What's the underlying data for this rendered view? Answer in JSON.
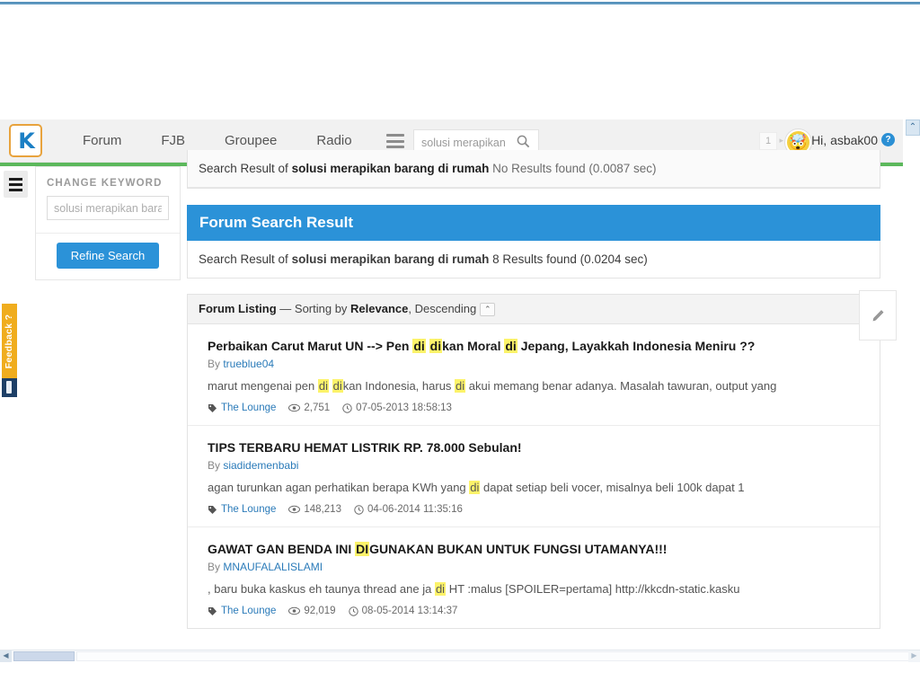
{
  "browser": {
    "scroll_top_label": "⌃"
  },
  "header": {
    "logo_text": "K",
    "nav": [
      {
        "label": "Forum"
      },
      {
        "label": "FJB"
      },
      {
        "label": "Groupee"
      },
      {
        "label": "Radio"
      }
    ],
    "search": {
      "value": "solusi merapikan barang di rumah",
      "placeholder": "solusi merapikan barang di rumah"
    },
    "notification_count": "1",
    "greeting": "Hi, asbak00",
    "user_badge": "?",
    "avatar_emoji": "🤯",
    "accent_green": "#5cb85c",
    "accent_blue": "#2b92d8",
    "logo_border": "#e8a33d"
  },
  "sidebar": {
    "title": "CHANGE KEYWORD",
    "keyword_value": "solusi merapikan barang di rumah",
    "keyword_placeholder": "solusi merapikan barang di rumah",
    "refine_label": "Refine Search"
  },
  "feedback_tab": {
    "label": "Feedback ?"
  },
  "main": {
    "fjb_result": {
      "prefix": "Search Result of ",
      "query": "solusi merapikan barang di rumah",
      "status": " No Results found (0.0087 sec)"
    },
    "forum_panel_title": "Forum Search Result",
    "forum_result": {
      "prefix": "Search Result of ",
      "query": "solusi merapikan barang di rumah",
      "status": " 8 Results found (0.0204 sec)"
    },
    "listing": {
      "label": "Forum Listing",
      "dash": " — Sorting by ",
      "sort_field": "Relevance",
      "sort_dir": ", Descending",
      "toggle": "⌃"
    },
    "by_prefix": "By ",
    "results": [
      {
        "title_parts": [
          {
            "t": "Perbaikan Carut Marut UN --> Pen ",
            "h": false
          },
          {
            "t": "di",
            "h": true
          },
          {
            "t": " ",
            "h": false
          },
          {
            "t": "di",
            "h": true
          },
          {
            "t": "kan Moral ",
            "h": false
          },
          {
            "t": "di",
            "h": true
          },
          {
            "t": " Jepang, Layakkah Indonesia Meniru ??",
            "h": false
          }
        ],
        "author": "trueblue04",
        "snippet_parts": [
          {
            "t": "marut mengenai pen ",
            "h": false
          },
          {
            "t": "di",
            "h": true
          },
          {
            "t": " ",
            "h": false
          },
          {
            "t": "di",
            "h": true
          },
          {
            "t": "kan Indonesia, harus ",
            "h": false
          },
          {
            "t": "di",
            "h": true
          },
          {
            "t": " akui memang benar adanya. Masalah tawuran, output yang",
            "h": false
          }
        ],
        "forum": "The Lounge",
        "views": "2,751",
        "date": "07-05-2013 18:58:13"
      },
      {
        "title_parts": [
          {
            "t": "TIPS TERBARU HEMAT LISTRIK RP. 78.000 Sebulan!",
            "h": false
          }
        ],
        "author": "siadidemenbabi",
        "snippet_parts": [
          {
            "t": "agan turunkan agan perhatikan berapa KWh yang ",
            "h": false
          },
          {
            "t": "di",
            "h": true
          },
          {
            "t": " dapat setiap beli vocer, misalnya beli 100k dapat 1",
            "h": false
          }
        ],
        "forum": "The Lounge",
        "views": "148,213",
        "date": "04-06-2014 11:35:16"
      },
      {
        "title_parts": [
          {
            "t": "GAWAT GAN BENDA INI ",
            "h": false
          },
          {
            "t": "DI",
            "h": true
          },
          {
            "t": "GUNAKAN BUKAN UNTUK FUNGSI UTAMANYA!!!",
            "h": false
          }
        ],
        "author": "MNAUFALALISLAMI",
        "snippet_parts": [
          {
            "t": ", baru buka kaskus eh taunya thread ane ja ",
            "h": false
          },
          {
            "t": "di",
            "h": true
          },
          {
            "t": " HT :malus [SPOILER=pertama] http://kkcdn-static.kasku",
            "h": false
          }
        ],
        "forum": "The Lounge",
        "views": "92,019",
        "date": "08-05-2014 13:14:37"
      }
    ]
  },
  "scrollbar": {
    "left_arrow": "◀",
    "right_arrow": "▶"
  }
}
